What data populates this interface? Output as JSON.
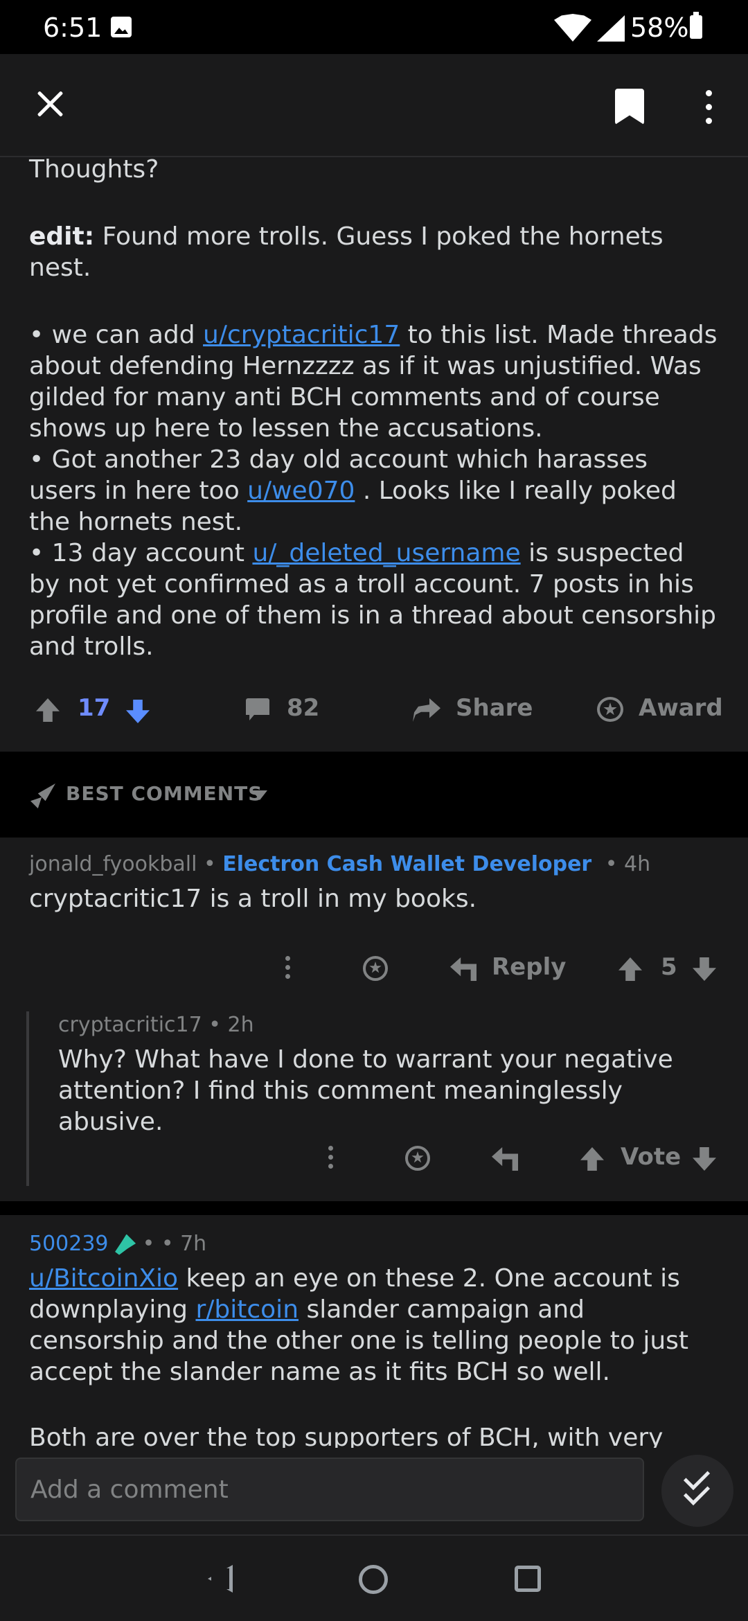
{
  "status_bar": {
    "time": "6:51",
    "battery": "58%"
  },
  "post": {
    "thoughts": "Thoughts?",
    "edit_label": "edit:",
    "edit_text": " Found more trolls. Guess I poked the hornets nest.",
    "bullet1_pre": "• we can add ",
    "bullet1_link": "u/cryptacritic17",
    "bullet1_post": " to this list. Made threads about defending Hernzzzz as if it was unjustified. Was gilded for many anti BCH comments and of course shows up here to lessen the accusations.",
    "bullet2_pre": "• Got another 23 day old account which harasses users in here too ",
    "bullet2_link": "u/we070",
    "bullet2_post": " . Looks like I really poked the hornets nest.",
    "bullet3_pre": "• 13 day account ",
    "bullet3_link": "u/_deleted_username",
    "bullet3_post": " is suspected by not yet confirmed as a troll account. 7 posts in his profile and one of them is in a thread about censorship and trolls."
  },
  "actions": {
    "votes": "17",
    "comments": "82",
    "share": "Share",
    "award": "Award"
  },
  "sort": {
    "label": "BEST COMMENTS"
  },
  "comments": [
    {
      "author": "jonald_fyookball",
      "flair": "Electron Cash Wallet Developer",
      "age": "• 4h",
      "body": "cryptacritic17 is a troll in my books.",
      "reply_label": "Reply",
      "score": "5"
    },
    {
      "author": "cryptacritic17",
      "age": "• 2h",
      "body": "Why? What have I done to warrant your negative attention? I find this comment meaninglessly abusive.",
      "vote_label": "Vote"
    },
    {
      "author": "500239",
      "age": "• • 7h",
      "body_link1": "u/BitcoinXio",
      "body_text1": " keep an eye on these 2. One account is downplaying ",
      "body_link2": "r/bitcoin",
      "body_text2": " slander campaign and censorship and the other one is telling people to just accept the slander name as it fits BCH so well.",
      "body_cut": "Both are over the top supporters of BCH, with very unique"
    }
  ],
  "comment_input": {
    "placeholder": "Add a comment"
  }
}
